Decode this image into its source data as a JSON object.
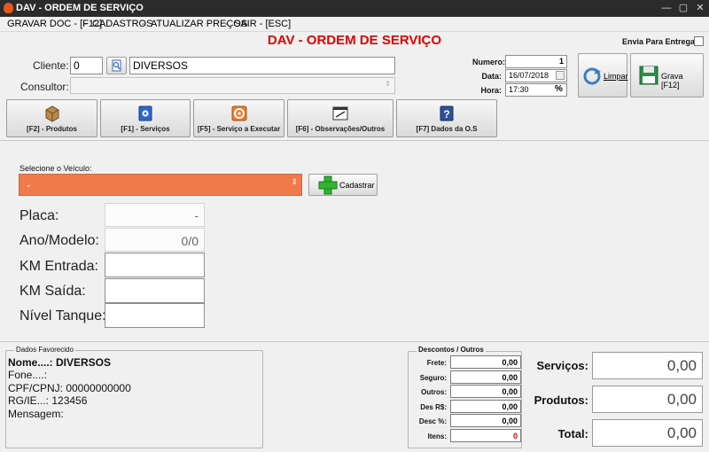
{
  "window": {
    "title": "DAV - ORDEM DE SERVIÇO",
    "minimize": "—",
    "maximize": "▢",
    "close": "✕"
  },
  "menu": [
    "GRAVAR DOC - [F12]",
    "CADASTROS",
    "ATUALIZAR PREÇOS",
    "SAIR - [ESC]"
  ],
  "header": {
    "title": "DAV - ORDEM DE SERVIÇO",
    "envia_entrega": "Envia Para Entrega"
  },
  "cliente": {
    "label": "Cliente:",
    "code": "0",
    "name": "DIVERSOS"
  },
  "consultor": {
    "label": "Consultor:",
    "value": ""
  },
  "doc": {
    "numero_label": "Numero:",
    "numero": "1",
    "data_label": "Data:",
    "data": "16/07/2018",
    "hora_label": "Hora:",
    "hora": "17:30"
  },
  "actions": {
    "limpar": "Limpar",
    "grava": "Grava [F12]"
  },
  "tabs": [
    {
      "label": "[F2] - Produtos"
    },
    {
      "label": "[F1] - Serviços"
    },
    {
      "label": "[F5] - Serviço a Executar"
    },
    {
      "label": "[F6] - Observações/Outros"
    },
    {
      "label": "[F7] Dados da O.S"
    }
  ],
  "vehicle": {
    "label": "Selecione o Veículo:",
    "selected": "-",
    "cadastrar": "Cadastrar"
  },
  "fields": {
    "placa_label": "Placa:",
    "placa": "-",
    "ano_label": "Ano/Modelo:",
    "ano": "0/0",
    "km_entrada_label": "KM Entrada:",
    "km_entrada": "",
    "km_saida_label": "KM Saída:",
    "km_saida": "",
    "nivel_label": "Nível Tanque:",
    "nivel": ""
  },
  "favorecido": {
    "title": "Dados Favorecido",
    "nome": "Nome....: DIVERSOS",
    "fone": "Fone....:",
    "cpf": "CPF/CPNJ: 00000000000",
    "rg": "RG/IE...: 123456",
    "mensagem": "Mensagem:"
  },
  "descontos": {
    "title": "Descontos / Outros",
    "rows": [
      {
        "label": "Frete:",
        "value": "0,00"
      },
      {
        "label": "Seguro:",
        "value": "0,00"
      },
      {
        "label": "Outros:",
        "value": "0,00"
      },
      {
        "label": "Des R$:",
        "value": "0,00"
      },
      {
        "label": "Desc %:",
        "value": "0,00"
      },
      {
        "label": "Itens:",
        "value": "0"
      }
    ]
  },
  "totals": {
    "servicos_label": "Serviços:",
    "servicos": "0,00",
    "produtos_label": "Produtos:",
    "produtos": "0,00",
    "total_label": "Total:",
    "total": "0,00"
  },
  "colors": {
    "title_red": "#e10000",
    "vehicle_orange": "#f07a4a",
    "itens_red": "#e00000"
  }
}
